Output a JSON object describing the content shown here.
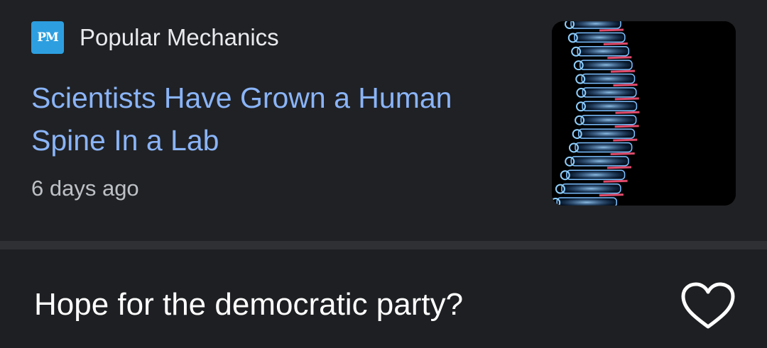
{
  "article": {
    "source_logo_text": "PM",
    "source_name": "Popular Mechanics",
    "headline": "Scientists Have Grown a Human Spine In a Lab",
    "timestamp": "6 days ago",
    "thumbnail_icon": "spine-xray-image"
  },
  "caption": {
    "text": "Hope for the democratic party?",
    "like_icon": "heart-outline-icon"
  },
  "colors": {
    "background": "#202124",
    "headline": "#8ab4f8",
    "source_text": "#e8eaed",
    "timestamp": "#bdc1c6",
    "logo_bg": "#2d9fe0",
    "caption_text": "#ffffff"
  }
}
